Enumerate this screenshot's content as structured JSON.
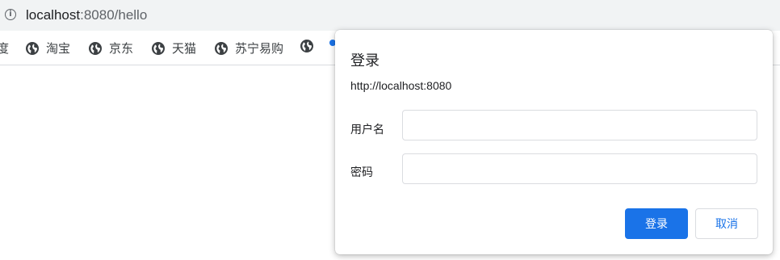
{
  "address_bar": {
    "url_host": "localhost",
    "url_rest": ":8080/hello"
  },
  "bookmarks": [
    {
      "label": "度",
      "icon": "none"
    },
    {
      "label": "淘宝",
      "icon": "globe-icon"
    },
    {
      "label": "京东",
      "icon": "globe-icon"
    },
    {
      "label": "天猫",
      "icon": "globe-icon"
    },
    {
      "label": "苏宁易购",
      "icon": "globe-icon"
    },
    {
      "label": "",
      "icon": "globe-icon"
    }
  ],
  "dialog": {
    "title": "登录",
    "origin": "http://localhost:8080",
    "username_label": "用户名",
    "username_value": "",
    "password_label": "密码",
    "password_value": "",
    "submit_label": "登录",
    "cancel_label": "取消"
  },
  "colors": {
    "accent": "#1a73e8",
    "toolbar_bg": "#f1f3f4",
    "border": "#dadce0"
  }
}
